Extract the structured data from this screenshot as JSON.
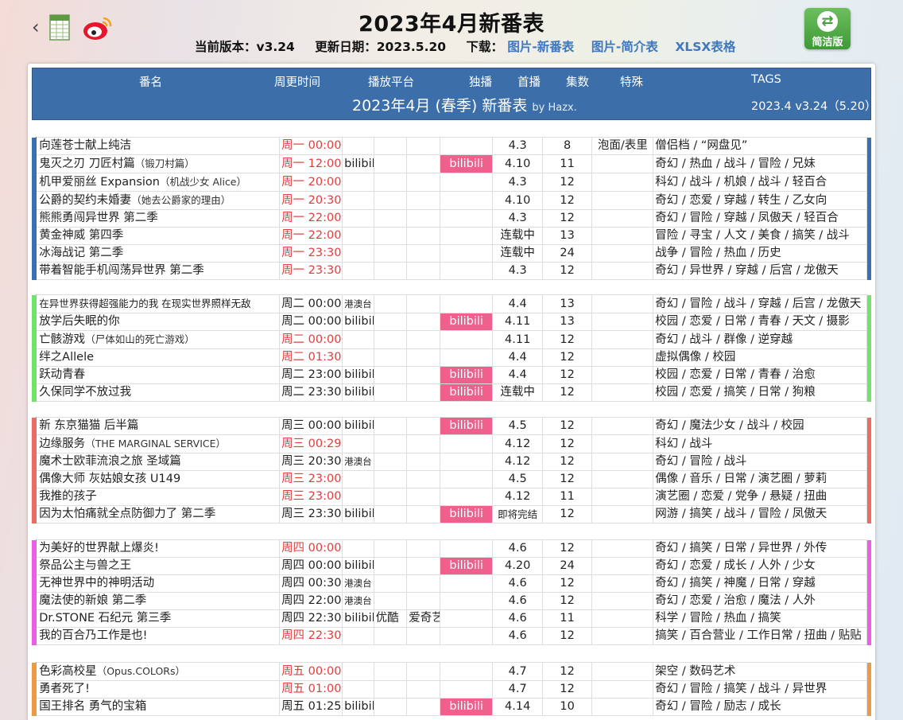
{
  "header": {
    "back_icon": "‹",
    "title": "2023年4月新番表",
    "version_label": "当前版本：v3.24",
    "update_label": "更新日期：2023.5.20",
    "download_label": "下载：",
    "links": [
      "图片-新番表",
      "图片-简介表",
      "XLSX表格"
    ],
    "simple_button": "简洁版",
    "simple_icon": "⇄"
  },
  "table_header": {
    "columns": [
      "番名",
      "周更时间",
      "播放平台",
      "独播",
      "首播",
      "集数",
      "特殊",
      "TAGS"
    ],
    "center_title": "2023年4月 (春季) 新番表",
    "by": "by Hazx.",
    "right_version": "2023.4 v3.24（5.20）"
  },
  "colors": {
    "mon": "#3a6fb0",
    "tue": "#6fe36a",
    "wed": "#ee6b63",
    "thu": "#ea60e4",
    "fri": "#eb9b45"
  },
  "groups": [
    {
      "color": "#3a6fb0",
      "rows": [
        {
          "name": "向莲苍士献上纯洁",
          "sub": "",
          "time": "周一 00:00",
          "red": true,
          "p1": "",
          "p2": "",
          "p3": "",
          "ex": "",
          "start": "4.3",
          "eps": "8",
          "spec": "泡面/表里",
          "tags": "僧侣档 / “网盘见”"
        },
        {
          "name": "鬼灭之刃 刀匠村篇",
          "sub": "（锻刀村篇）",
          "time": "周一 12:00",
          "red": true,
          "p1": "bilibili",
          "p2": "",
          "p3": "",
          "ex": "bilibili",
          "start": "4.10",
          "eps": "11",
          "spec": "",
          "tags": "奇幻 / 热血 / 战斗 / 冒险 / 兄妹"
        },
        {
          "name": "机甲爱丽丝 Expansion",
          "sub": "（机战少女 Alice）",
          "time": "周一 20:00",
          "red": true,
          "p1": "",
          "p2": "",
          "p3": "",
          "ex": "",
          "start": "4.3",
          "eps": "12",
          "spec": "",
          "tags": "科幻 / 战斗 / 机娘 / 战斗 / 轻百合"
        },
        {
          "name": "公爵的契约未婚妻",
          "sub": "（她去公爵家的理由）",
          "time": "周一 20:30",
          "red": true,
          "p1": "",
          "p2": "",
          "p3": "",
          "ex": "",
          "start": "4.10",
          "eps": "12",
          "spec": "",
          "tags": "奇幻 / 恋爱 / 穿越 / 转生 / 乙女向"
        },
        {
          "name": "熊熊勇闯异世界 第二季",
          "sub": "",
          "time": "周一 22:00",
          "red": true,
          "p1": "",
          "p2": "",
          "p3": "",
          "ex": "",
          "start": "4.3",
          "eps": "12",
          "spec": "",
          "tags": "奇幻 / 冒险 / 穿越 / 凤傲天 / 轻百合"
        },
        {
          "name": "黄金神威 第四季",
          "sub": "",
          "time": "周一 22:00",
          "red": true,
          "p1": "",
          "p2": "",
          "p3": "",
          "ex": "",
          "start": "连载中",
          "eps": "13",
          "spec": "",
          "tags": "冒险 / 寻宝 / 人文 / 美食 / 搞笑 / 战斗"
        },
        {
          "name": "冰海战记 第二季",
          "sub": "",
          "time": "周一 23:30",
          "red": true,
          "p1": "",
          "p2": "",
          "p3": "",
          "ex": "",
          "start": "连载中",
          "eps": "24",
          "spec": "",
          "tags": "战争 / 冒险 / 热血 / 历史"
        },
        {
          "name": "带着智能手机闯荡异世界 第二季",
          "sub": "",
          "time": "周一 23:30",
          "red": true,
          "p1": "",
          "p2": "",
          "p3": "",
          "ex": "",
          "start": "4.3",
          "eps": "12",
          "spec": "",
          "tags": "奇幻 / 异世界 / 穿越 / 后宫 / 龙傲天"
        }
      ]
    },
    {
      "color": "#6fe36a",
      "rows": [
        {
          "name": "在异世界获得超强能力的我 在现实世界照样无敌",
          "sub": "",
          "small": true,
          "time": "周二 00:00",
          "red": false,
          "p1": "港澳台",
          "p1s": true,
          "p2": "",
          "p3": "",
          "ex": "",
          "start": "4.4",
          "eps": "13",
          "spec": "",
          "tags": "奇幻 / 冒险 / 战斗 / 穿越 / 后宫 / 龙傲天"
        },
        {
          "name": "放学后失眠的你",
          "sub": "",
          "time": "周二 00:00",
          "red": false,
          "p1": "bilibili",
          "p2": "",
          "p3": "",
          "ex": "bilibili",
          "start": "4.11",
          "eps": "13",
          "spec": "",
          "tags": "校园 / 恋爱 / 日常 / 青春 / 天文 / 摄影"
        },
        {
          "name": "亡骸游戏",
          "sub": "（尸体如山的死亡游戏）",
          "time": "周二 00:00",
          "red": true,
          "p1": "",
          "p2": "",
          "p3": "",
          "ex": "",
          "start": "4.11",
          "eps": "12",
          "spec": "",
          "tags": "奇幻 / 战斗 / 群像 / 逆穿越"
        },
        {
          "name": "绊之Allele",
          "sub": "",
          "time": "周二 01:30",
          "red": true,
          "p1": "",
          "p2": "",
          "p3": "",
          "ex": "",
          "start": "4.4",
          "eps": "12",
          "spec": "",
          "tags": "虚拟偶像 / 校园"
        },
        {
          "name": "跃动青春",
          "sub": "",
          "time": "周二 23:00",
          "red": false,
          "p1": "bilibili",
          "p2": "",
          "p3": "",
          "ex": "bilibili",
          "start": "4.4",
          "eps": "12",
          "spec": "",
          "tags": "校园 / 恋爱 / 日常 / 青春 / 治愈"
        },
        {
          "name": "久保同学不放过我",
          "sub": "",
          "time": "周二 23:30",
          "red": false,
          "p1": "bilibili",
          "p2": "",
          "p3": "",
          "ex": "bilibili",
          "start": "连载中",
          "eps": "12",
          "spec": "",
          "tags": "校园 / 恋爱 / 搞笑 / 日常 / 狗粮"
        }
      ]
    },
    {
      "color": "#ee6b63",
      "rows": [
        {
          "name": "新 东京猫猫 后半篇",
          "sub": "",
          "time": "周三 00:00",
          "red": false,
          "p1": "bilibili",
          "p2": "",
          "p3": "",
          "ex": "bilibili",
          "start": "4.5",
          "eps": "12",
          "spec": "",
          "tags": "奇幻 / 魔法少女 / 战斗 / 校园"
        },
        {
          "name": "边缘服务",
          "sub": "（THE MARGINAL SERVICE）",
          "time": "周三 00:29",
          "red": true,
          "p1": "",
          "p2": "",
          "p3": "",
          "ex": "",
          "start": "4.12",
          "eps": "12",
          "spec": "",
          "tags": "科幻 / 战斗"
        },
        {
          "name": "魔术士欧菲流浪之旅 圣域篇",
          "sub": "",
          "time": "周三 20:30",
          "red": false,
          "p1": "港澳台",
          "p1s": true,
          "p2": "",
          "p3": "",
          "ex": "",
          "start": "4.12",
          "eps": "12",
          "spec": "",
          "tags": "奇幻 / 冒险 / 战斗"
        },
        {
          "name": "偶像大师 灰姑娘女孩 U149",
          "sub": "",
          "time": "周三 23:00",
          "red": true,
          "p1": "",
          "p2": "",
          "p3": "",
          "ex": "",
          "start": "4.5",
          "eps": "12",
          "spec": "",
          "tags": "偶像 / 音乐 / 日常 / 演艺圈 / 萝莉"
        },
        {
          "name": "我推的孩子",
          "sub": "",
          "time": "周三 23:00",
          "red": true,
          "p1": "",
          "p2": "",
          "p3": "",
          "ex": "",
          "start": "4.12",
          "eps": "11",
          "spec": "",
          "tags": "演艺圈 / 恋爱 / 党争 / 悬疑 / 扭曲"
        },
        {
          "name": "因为太怕痛就全点防御力了 第二季",
          "sub": "",
          "time": "周三 23:30",
          "red": false,
          "p1": "bilibili",
          "p2": "",
          "p3": "",
          "ex": "bilibili",
          "start": "即将完结",
          "startsm": true,
          "eps": "12",
          "spec": "",
          "tags": "网游 / 搞笑 / 战斗 / 冒险 / 凤傲天"
        }
      ]
    },
    {
      "color": "#ea60e4",
      "rows": [
        {
          "name": "为美好的世界献上爆炎!",
          "sub": "",
          "time": "周四 00:00",
          "red": true,
          "p1": "",
          "p2": "",
          "p3": "",
          "ex": "",
          "start": "4.6",
          "eps": "12",
          "spec": "",
          "tags": "奇幻 / 搞笑 / 日常 / 异世界 / 外传"
        },
        {
          "name": "祭品公主与兽之王",
          "sub": "",
          "time": "周四 00:00",
          "red": false,
          "p1": "bilibili",
          "p2": "",
          "p3": "",
          "ex": "bilibili",
          "start": "4.20",
          "eps": "24",
          "spec": "",
          "tags": "奇幻 / 恋爱 / 成长 / 人外 / 少女"
        },
        {
          "name": "无神世界中的神明活动",
          "sub": "",
          "time": "周四 00:30",
          "red": false,
          "p1": "港澳台",
          "p1s": true,
          "p2": "",
          "p3": "",
          "ex": "",
          "start": "4.6",
          "eps": "12",
          "spec": "",
          "tags": "奇幻 / 搞笑 / 神魔 / 日常 / 穿越"
        },
        {
          "name": "魔法使的新娘 第二季",
          "sub": "",
          "time": "周四 22:00",
          "red": false,
          "p1": "港澳台",
          "p1s": true,
          "p2": "",
          "p3": "",
          "ex": "",
          "start": "4.6",
          "eps": "12",
          "spec": "",
          "tags": "奇幻 / 恋爱 / 治愈 / 魔法 / 人外"
        },
        {
          "name": "Dr.STONE 石纪元 第三季",
          "sub": "",
          "time": "周四 22:30",
          "red": false,
          "p1": "bilibili",
          "p2": "优酷",
          "p3": "爱奇艺",
          "ex": "",
          "start": "4.6",
          "eps": "11",
          "spec": "",
          "tags": "科学 / 冒险 / 热血 / 搞笑"
        },
        {
          "name": "我的百合乃工作是也!",
          "sub": "",
          "time": "周四 22:30",
          "red": true,
          "p1": "",
          "p2": "",
          "p3": "",
          "ex": "",
          "start": "4.6",
          "eps": "12",
          "spec": "",
          "tags": "搞笑 / 百合营业 / 工作日常 / 扭曲 / 贴贴"
        }
      ]
    },
    {
      "color": "#eb9b45",
      "rows": [
        {
          "name": "色彩高校星",
          "sub": "（Opus.COLORs）",
          "time": "周五 00:00",
          "red": true,
          "p1": "",
          "p2": "",
          "p3": "",
          "ex": "",
          "start": "4.7",
          "eps": "12",
          "spec": "",
          "tags": "架空 / 数码艺术"
        },
        {
          "name": "勇者死了!",
          "sub": "",
          "time": "周五 01:00",
          "red": true,
          "p1": "",
          "p2": "",
          "p3": "",
          "ex": "",
          "start": "4.7",
          "eps": "12",
          "spec": "",
          "tags": "奇幻 / 冒险 / 搞笑 / 战斗 / 异世界"
        },
        {
          "name": "国王排名 勇气的宝箱",
          "sub": "",
          "time": "周五 01:25",
          "red": false,
          "p1": "bilibili",
          "p2": "",
          "p3": "",
          "ex": "bilibili",
          "start": "4.14",
          "eps": "10",
          "spec": "",
          "tags": "奇幻 / 冒险 / 励志 / 成长"
        }
      ]
    }
  ]
}
